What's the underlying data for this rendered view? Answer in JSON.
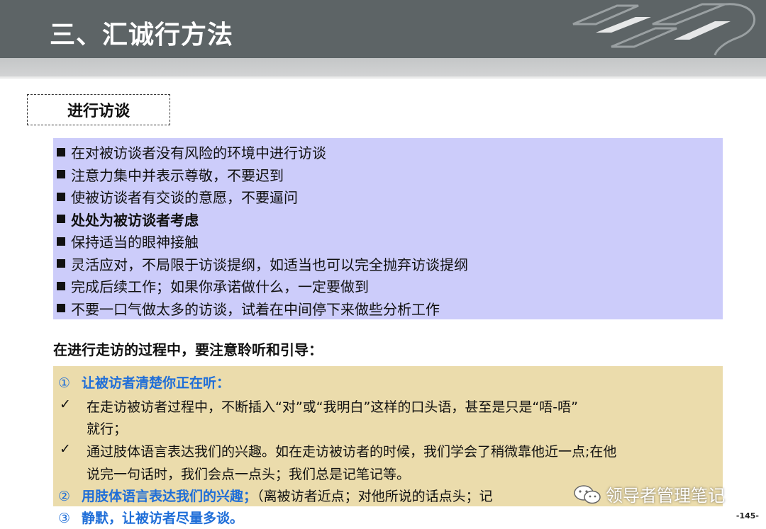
{
  "header": {
    "title": "三、汇诚行方法",
    "logo": "company-logo-mark"
  },
  "section": {
    "title": "进行访谈"
  },
  "tips": [
    {
      "text": "在对被访谈者没有风险的环境中进行访谈",
      "bold": false
    },
    {
      "text": "注意力集中并表示尊敬，不要迟到",
      "bold": false
    },
    {
      "text": "使被访谈者有交谈的意愿，不要逼问",
      "bold": false
    },
    {
      "text": "处处为被访谈者考虑",
      "bold": true
    },
    {
      "text": "保持适当的眼神接触",
      "bold": false
    },
    {
      "text": "灵活应对，不局限于访谈提纲，如适当也可以完全抛弃访谈提纲",
      "bold": false
    },
    {
      "text": "完成后续工作；如果你承诺做什么，一定要做到",
      "bold": false
    },
    {
      "text": "不要一口气做太多的访谈，试着在中间停下来做些分析工作",
      "bold": false
    }
  ],
  "subheading": "在进行走访的过程中，要注意聆听和引导：",
  "listening": {
    "point1": {
      "num": "①",
      "label": "让被访者清楚你正在听："
    },
    "check_mark": "✓",
    "check1": {
      "line1": "在走访被访者过程中，不断插入“对”或“我明白”这样的口头语，甚至是只是“唔-唔”",
      "line2": "就行；"
    },
    "check2": {
      "line1": "通过肢体语言表达我们的兴趣。如在走访被访者的时候，我们学会了稍微靠他近一点;在他",
      "line2": "说完一句话时，我们会点一点头；我们总是记笔记等。"
    },
    "point2": {
      "num": "②",
      "label": "用肢体语言表达我们的兴趣；",
      "detail": "（离被访者近点；对他所说的话点头；记"
    },
    "point3": {
      "num": "③",
      "label": "静默，让被访者尽量多谈。"
    }
  },
  "watermark": {
    "text": "领导者管理笔记",
    "icon": "wechat-icon"
  },
  "page_number": "-145-",
  "colors": {
    "header": "#5d6466",
    "tips_bg": "#ccccfa",
    "listen_bg": "#ebdcac",
    "accent_blue": "#1f6ed8"
  }
}
